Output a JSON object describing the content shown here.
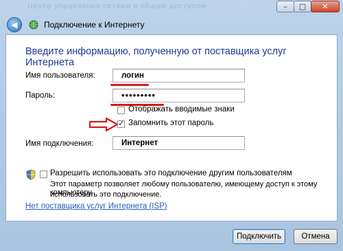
{
  "window": {
    "blurred_title_left": "Центр управления сетями и общим доступом",
    "blurred_title_right": "",
    "nav_title": "Подключение к Интернету"
  },
  "form": {
    "heading": "Введите информацию, полученную от поставщика услуг Интернета",
    "username_label": "Имя пользователя:",
    "username_value": "логин",
    "password_label": "Пароль:",
    "password_value": "•••••••••",
    "show_chars_label": "Отображать вводимые знаки",
    "show_chars_checked": false,
    "remember_label": "Запомнить этот пароль",
    "remember_checked": true,
    "connection_name_label": "Имя подключения:",
    "connection_name_value": "Интернет",
    "share_label": "Разрешить использовать это подключение другим пользователям",
    "share_checked": false,
    "share_desc_line1": "Этот параметр позволяет любому пользователю, имеющему доступ к этому компьютеру,",
    "share_desc_line2": "использовать это подключение.",
    "isp_link": "Нет поставщика услуг Интернета (ISP)"
  },
  "buttons": {
    "connect": "Подключить",
    "cancel": "Отмена"
  },
  "window_controls": {
    "minimize_glyph": "–",
    "maximize_glyph": "□",
    "close_glyph": "✕"
  },
  "annotation": {
    "underline_color": "#d81a1a",
    "arrow_color": "#d81a1a"
  },
  "colors": {
    "heading": "#1e3c96",
    "link": "#1f5fbf"
  },
  "icons": [
    "back-arrow-icon",
    "network-icon",
    "shield-icon",
    "checkmark-icon"
  ]
}
